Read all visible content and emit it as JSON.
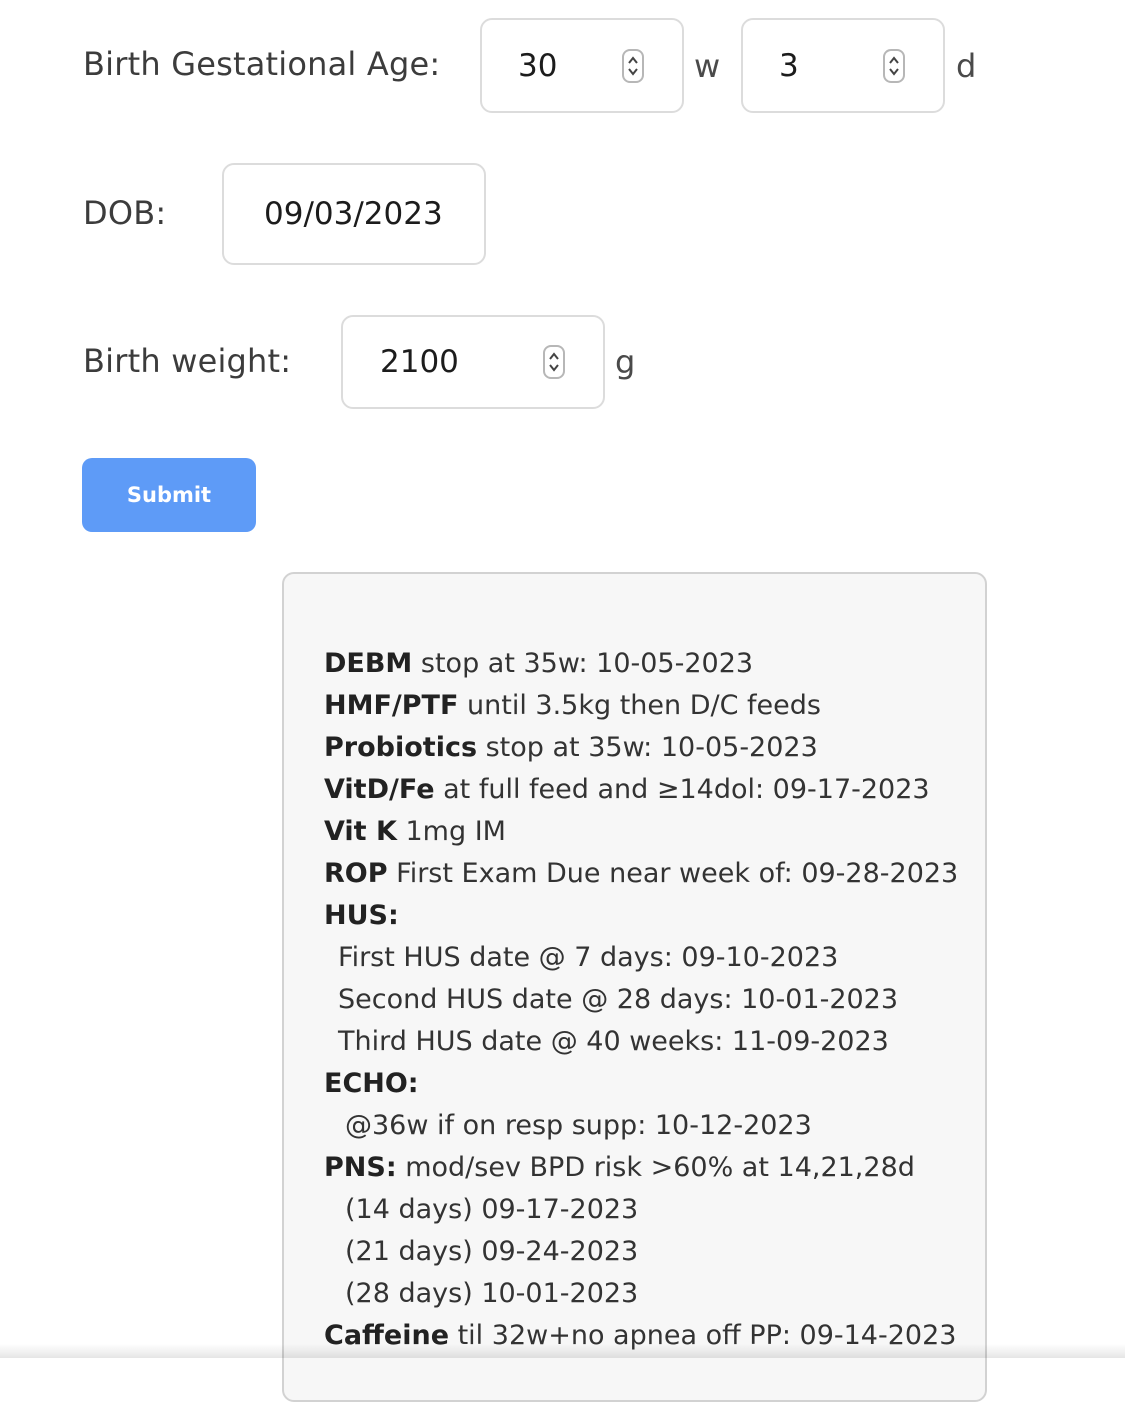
{
  "gestational_age": {
    "label": "Birth Gestational Age:",
    "weeks_value": "30",
    "weeks_unit": "w",
    "days_value": "3",
    "days_unit": "d"
  },
  "dob": {
    "label": "DOB:",
    "value": "09/03/2023"
  },
  "birth_weight": {
    "label": "Birth weight:",
    "value": "2100",
    "unit": "g"
  },
  "submit": {
    "label": "Submit"
  },
  "results": {
    "debm": {
      "bold": "DEBM",
      "text": " stop at 35w: 10-05-2023"
    },
    "hmf": {
      "bold": "HMF/PTF",
      "text": " until 3.5kg then D/C feeds"
    },
    "probiotics": {
      "bold": "Probiotics",
      "text": " stop at 35w: 10-05-2023"
    },
    "vitd": {
      "bold": "VitD/Fe",
      "text": " at full feed and ≥14dol: 09-17-2023"
    },
    "vitk": {
      "bold": "Vit K",
      "text": " 1mg IM"
    },
    "rop": {
      "bold": "ROP",
      "text": " First Exam Due near week of: 09-28-2023"
    },
    "hus_header": "HUS:",
    "hus_items": [
      "First HUS date @ 7 days: 09-10-2023",
      "Second HUS date @ 28 days: 10-01-2023",
      "Third HUS date @ 40 weeks: 11-09-2023"
    ],
    "echo_header": "ECHO:",
    "echo_items": [
      "@36w if on resp supp: 10-12-2023"
    ],
    "pns": {
      "bold": "PNS:",
      "text": " mod/sev BPD risk >60% at 14,21,28d"
    },
    "pns_items": [
      "(14 days) 09-17-2023",
      "(21 days) 09-24-2023",
      "(28 days) 10-01-2023"
    ],
    "caffeine": {
      "bold": "Caffeine",
      "text": " til 32w+no apnea off PP: 09-14-2023"
    }
  }
}
